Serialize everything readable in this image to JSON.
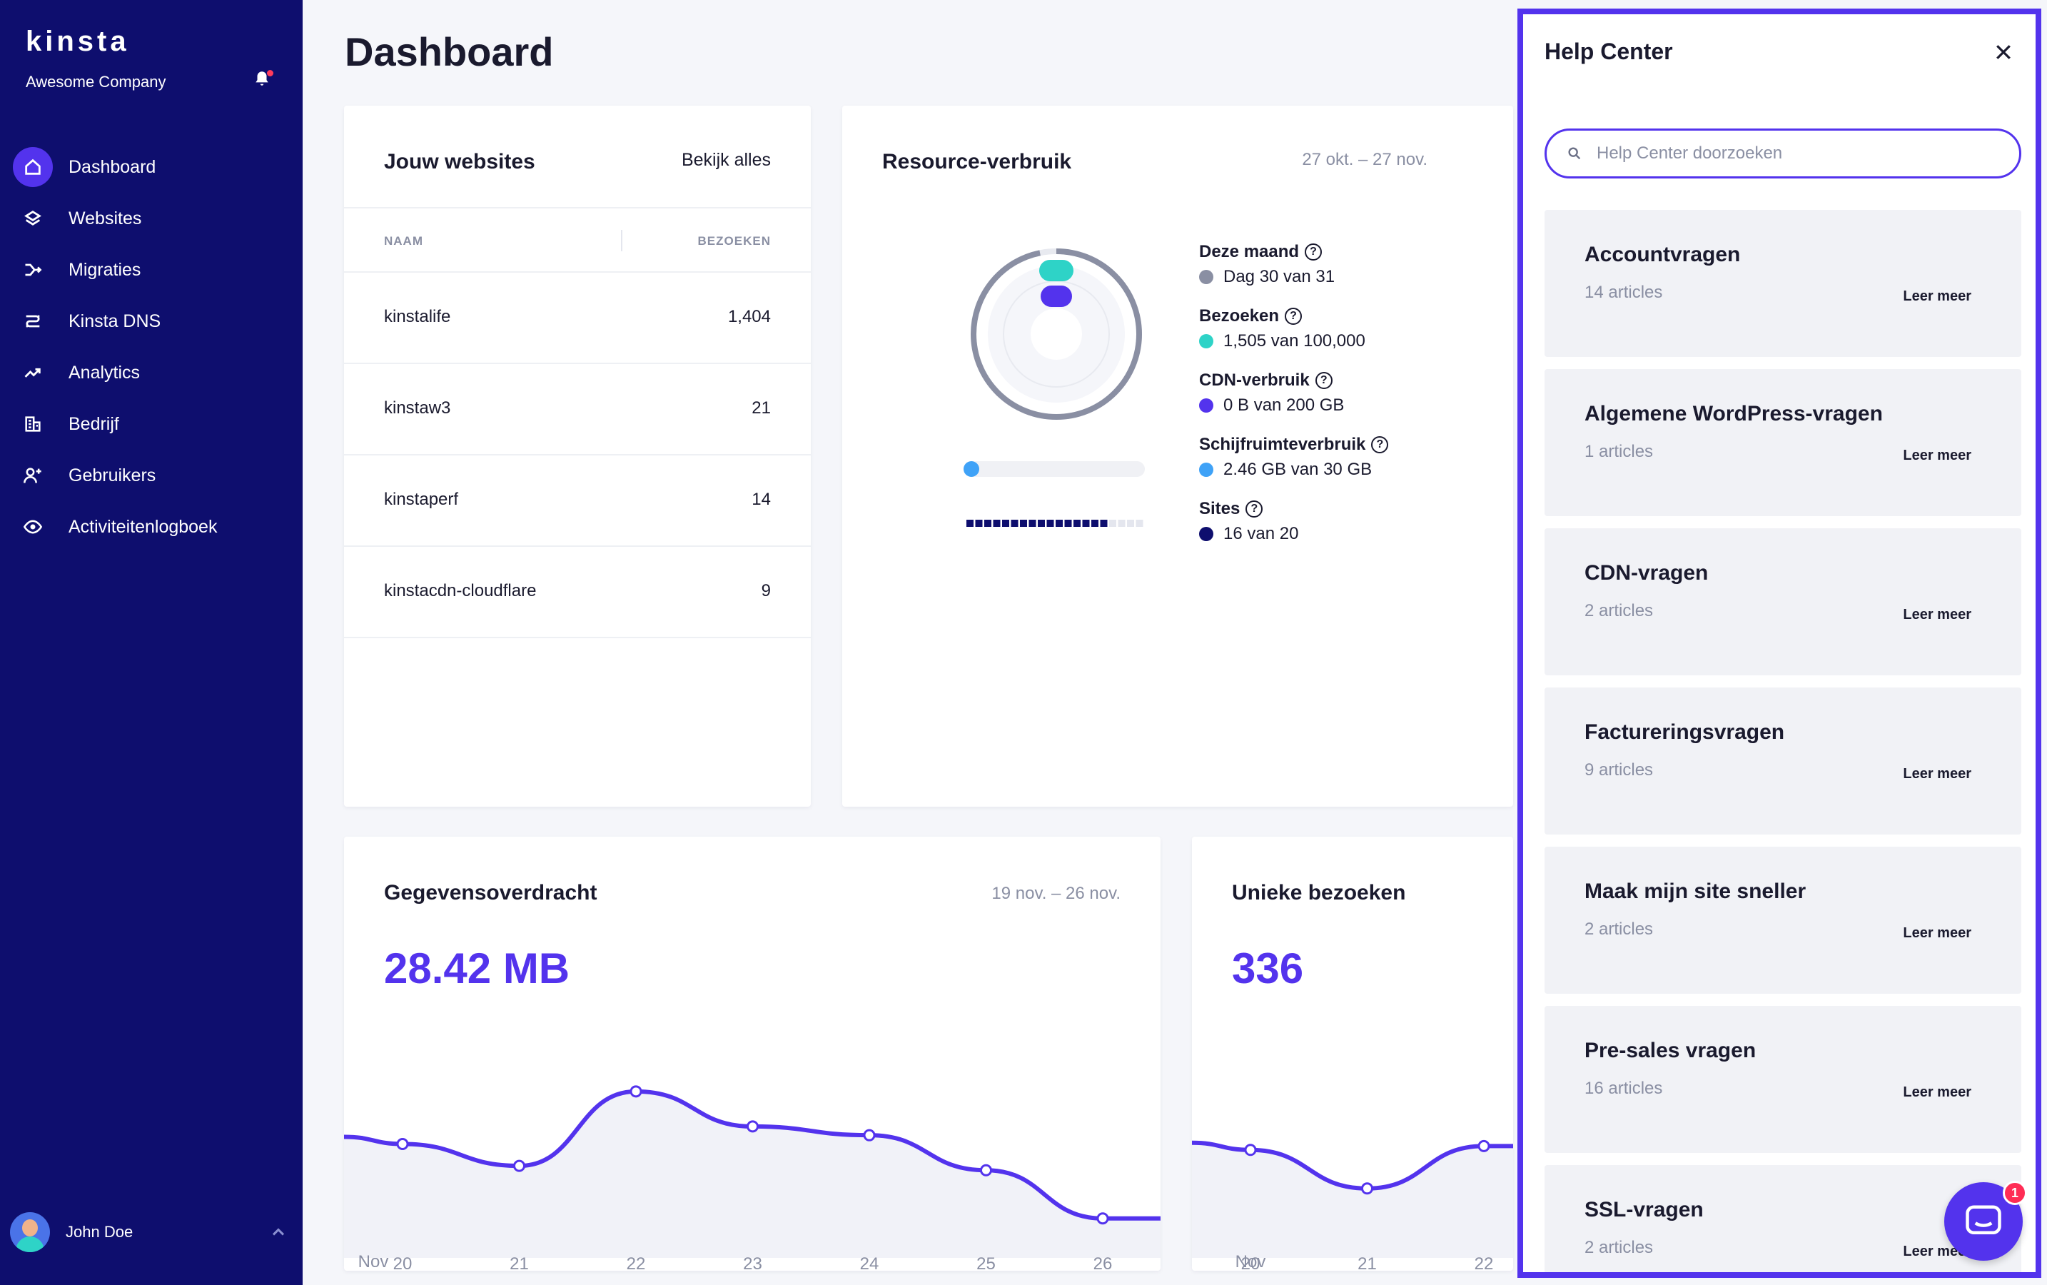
{
  "sidebar": {
    "logo": "KINSTA",
    "company": "Awesome Company",
    "items": [
      {
        "label": "Dashboard",
        "icon": "home-icon"
      },
      {
        "label": "Websites",
        "icon": "layers-icon"
      },
      {
        "label": "Migraties",
        "icon": "migrate-icon"
      },
      {
        "label": "Kinsta DNS",
        "icon": "dns-icon"
      },
      {
        "label": "Analytics",
        "icon": "trend-icon"
      },
      {
        "label": "Bedrijf",
        "icon": "building-icon"
      },
      {
        "label": "Gebruikers",
        "icon": "add-user-icon"
      },
      {
        "label": "Activiteitenlogboek",
        "icon": "eye-icon"
      }
    ],
    "user_name": "John Doe"
  },
  "page_title": "Dashboard",
  "websites": {
    "title": "Jouw websites",
    "see_all": "Bekijk alles",
    "col_name": "NAAM",
    "col_visits": "BEZOEKEN",
    "rows": [
      {
        "name": "kinstalife",
        "visits": "1,404"
      },
      {
        "name": "kinstaw3",
        "visits": "21"
      },
      {
        "name": "kinstaperf",
        "visits": "14"
      },
      {
        "name": "kinstacdn-cloudflare",
        "visits": "9"
      }
    ]
  },
  "resource": {
    "title": "Resource-verbruik",
    "date_range": "27 okt. – 27 nov.",
    "legend": [
      {
        "title": "Deze maand",
        "value": "Dag 30 van 31",
        "color": "#8a8fa3"
      },
      {
        "title": "Bezoeken",
        "value": "1,505 van 100,000",
        "color": "#2ed3c7"
      },
      {
        "title": "CDN-verbruik",
        "value": "0 B van 200 GB",
        "color": "#5333ed"
      },
      {
        "title": "Schijfruimteverbruik",
        "value": "2.46 GB van 30 GB",
        "color": "#3fa2f7"
      },
      {
        "title": "Sites",
        "value": "16 van 20",
        "color": "#0e0e6e"
      }
    ],
    "progress": {
      "month": 0.968,
      "visits": 0.015,
      "cdn": 0.0,
      "disk": 0.082,
      "sites_used": 16,
      "sites_total": 20
    }
  },
  "transfer": {
    "title": "Gegevensoverdracht",
    "date_range": "19 nov. – 26 nov.",
    "total": "28.42 MB",
    "month_label": "Nov"
  },
  "unique_visits": {
    "title": "Unieke bezoeken",
    "total": "336",
    "month_label": "Nov"
  },
  "chart_data": [
    {
      "type": "area",
      "title": "Gegevensoverdracht",
      "x": [
        "20",
        "21",
        "22",
        "23",
        "24",
        "25",
        "26"
      ],
      "values": [
        3.6,
        3.1,
        4.8,
        4.0,
        3.8,
        3.0,
        1.9
      ],
      "color": "#5333ed"
    },
    {
      "type": "area",
      "title": "Unieke bezoeken",
      "x": [
        "20",
        "21",
        "22"
      ],
      "values": [
        48,
        38,
        49
      ],
      "color": "#5333ed"
    }
  ],
  "help": {
    "title": "Help Center",
    "search_placeholder": "Help Center doorzoeken",
    "categories": [
      {
        "name": "Accountvragen",
        "count": "14 articles",
        "more": "Leer meer"
      },
      {
        "name": "Algemene WordPress-vragen",
        "count": "1 articles",
        "more": "Leer meer"
      },
      {
        "name": "CDN-vragen",
        "count": "2 articles",
        "more": "Leer meer"
      },
      {
        "name": "Factureringsvragen",
        "count": "9 articles",
        "more": "Leer meer"
      },
      {
        "name": "Maak mijn site sneller",
        "count": "2 articles",
        "more": "Leer meer"
      },
      {
        "name": "Pre-sales vragen",
        "count": "16 articles",
        "more": "Leer meer"
      },
      {
        "name": "SSL-vragen",
        "count": "2 articles",
        "more": "Leer meer"
      }
    ],
    "chat_badge": "1"
  }
}
